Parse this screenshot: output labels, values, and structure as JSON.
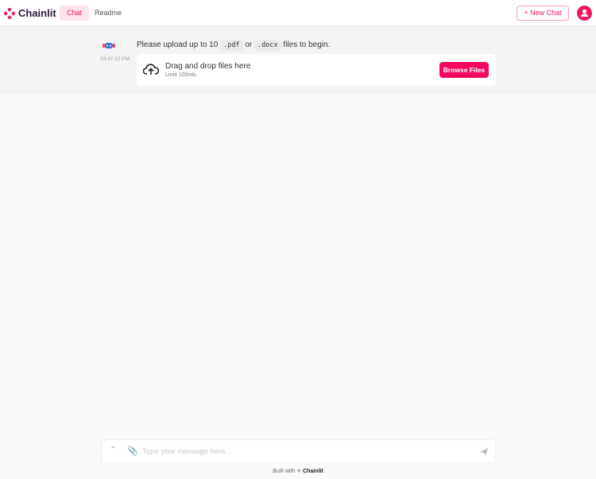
{
  "header": {
    "brand": "Chainlit",
    "tabs": [
      {
        "label": "Chat",
        "active": true
      },
      {
        "label": "Readme",
        "active": false
      }
    ],
    "new_chat": "New Chat"
  },
  "message": {
    "timestamp": "03:47:12 PM",
    "text_before": "Please upload up to 10",
    "code1": ".pdf",
    "or": "or",
    "code2": ".docx",
    "text_after": "files to begin."
  },
  "upload": {
    "title": "Drag and drop files here",
    "limit": "Limit 100mb.",
    "button": "Browse Files"
  },
  "composer": {
    "placeholder": "Type your message here..."
  },
  "footer": {
    "built_with": "Built with",
    "brand": "Chainlit"
  },
  "colors": {
    "accent": "#f5075f"
  }
}
